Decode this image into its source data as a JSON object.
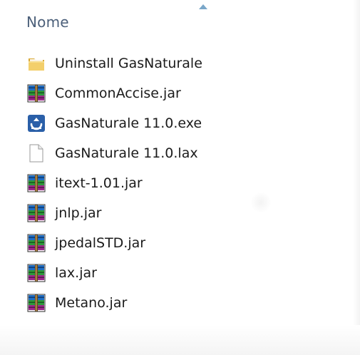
{
  "header": {
    "name_column_label": "Nome"
  },
  "files": [
    {
      "name": "Uninstall GasNaturale",
      "icon": "folder-icon"
    },
    {
      "name": "CommonAccise.jar",
      "icon": "winrar-archive-icon"
    },
    {
      "name": "GasNaturale 11.0.exe",
      "icon": "application-icon"
    },
    {
      "name": "GasNaturale 11.0.lax",
      "icon": "blank-file-icon"
    },
    {
      "name": "itext-1.01.jar",
      "icon": "winrar-archive-icon"
    },
    {
      "name": "jnlp.jar",
      "icon": "winrar-archive-icon"
    },
    {
      "name": "jpedalSTD.jar",
      "icon": "winrar-archive-icon"
    },
    {
      "name": "lax.jar",
      "icon": "winrar-archive-icon"
    },
    {
      "name": "Metano.jar",
      "icon": "winrar-archive-icon"
    }
  ],
  "colors": {
    "header_text": "#4c607a",
    "file_text": "#1b1b1b",
    "folder": "#e8c15a",
    "app_blue": "#2a5fa8"
  }
}
